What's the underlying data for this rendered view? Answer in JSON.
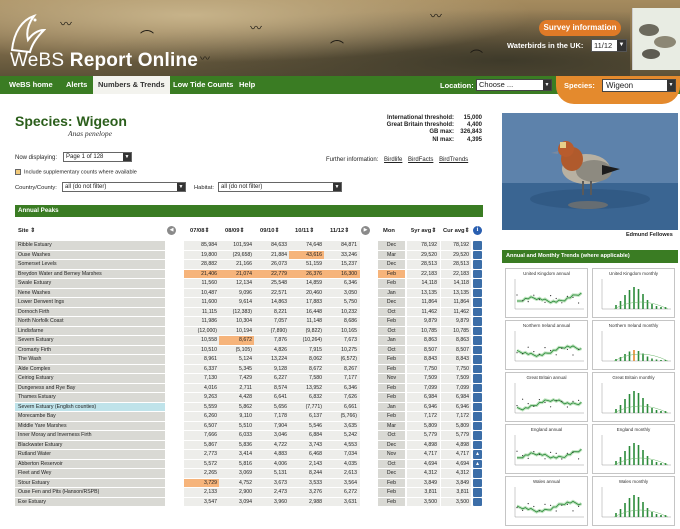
{
  "header": {
    "logo_prefix": "WeBS",
    "logo_suffix": "Report Online",
    "survey_button": "Survey information",
    "waterbirds_label": "Waterbirds in the UK:",
    "waterbirds_year": "11/12"
  },
  "nav": {
    "items": [
      "WeBS home",
      "Alerts",
      "Numbers & Trends",
      "Low Tide Counts",
      "Help"
    ],
    "location_label": "Location:",
    "location_value": "Choose ...",
    "species_label": "Species:",
    "species_value": "Wigeon"
  },
  "species": {
    "title": "Species: Wigeon",
    "latin": "Anas penelope"
  },
  "thresholds": [
    {
      "label": "International threshold:",
      "value": "15,000"
    },
    {
      "label": "Great Britain threshold:",
      "value": "4,400"
    },
    {
      "label": "GB max:",
      "value": "326,843"
    },
    {
      "label": "NI max:",
      "value": "4,395"
    }
  ],
  "further_info": {
    "label": "Further information:",
    "links": [
      "Birdlife",
      "BirdFacts",
      "BirdTrends"
    ]
  },
  "controls": {
    "displaying_label": "Now displaying:",
    "page_value": "Page 1 of 128",
    "supplementary_label": "Include supplementary counts where available",
    "country_label": "Country/County:",
    "country_value": "all (do not filter)",
    "habitat_label": "Habitat:",
    "habitat_value": "all (do not filter)"
  },
  "table": {
    "title": "Annual Peaks",
    "headers": {
      "site": "Site",
      "years": [
        "07/08",
        "08/09",
        "09/10",
        "10/11",
        "11/12"
      ],
      "mon": "Mon",
      "avg1": "5yr avg",
      "avg2": "Cur avg"
    },
    "rows": [
      {
        "site": "Ribble Estuary",
        "vals": [
          "85,984",
          "101,594",
          "84,633",
          "74,648",
          "84,871"
        ],
        "mon": "Dec",
        "avg1": "78,192",
        "avg2": "78,192",
        "status": "blue"
      },
      {
        "site": "Ouse Washes",
        "vals": [
          "19,800",
          "(29,658)",
          "21,884",
          "43,616",
          "33,246"
        ],
        "mon": "Mar",
        "avg1": "29,520",
        "avg2": "29,520",
        "status": "blue",
        "hl_col": 3
      },
      {
        "site": "Somerset Levels",
        "vals": [
          "28,882",
          "21,166",
          "26,073",
          "51,159",
          "15,237"
        ],
        "mon": "Dec",
        "avg1": "28,513",
        "avg2": "28,513",
        "status": "blue"
      },
      {
        "site": "Breydon Water and Berney Marshes",
        "vals": [
          "21,406",
          "21,074",
          "22,779",
          "26,376",
          "16,300"
        ],
        "mon": "Feb",
        "avg1": "22,183",
        "avg2": "22,183",
        "status": "blue",
        "hl_row": true
      },
      {
        "site": "Swale Estuary",
        "vals": [
          "11,560",
          "12,134",
          "25,548",
          "14,859",
          "6,346"
        ],
        "mon": "Feb",
        "avg1": "14,118",
        "avg2": "14,118",
        "status": "blue"
      },
      {
        "site": "Nene Washes",
        "vals": [
          "10,487",
          "9,096",
          "22,571",
          "20,460",
          "3,050"
        ],
        "mon": "Jan",
        "avg1": "13,135",
        "avg2": "13,135",
        "status": "blue"
      },
      {
        "site": "Lower Derwent Ings",
        "vals": [
          "11,600",
          "9,614",
          "14,863",
          "17,883",
          "5,750"
        ],
        "mon": "Dec",
        "avg1": "11,864",
        "avg2": "11,864",
        "status": "blue"
      },
      {
        "site": "Dornoch Firth",
        "vals": [
          "11,115",
          "(12,383)",
          "8,221",
          "16,448",
          "10,232"
        ],
        "mon": "Oct",
        "avg1": "11,462",
        "avg2": "11,462",
        "status": "blue"
      },
      {
        "site": "North Norfolk Coast",
        "vals": [
          "11,986",
          "10,304",
          "7,057",
          "11,148",
          "8,686"
        ],
        "mon": "Feb",
        "avg1": "9,879",
        "avg2": "9,879",
        "status": "blue"
      },
      {
        "site": "Lindisfarne",
        "vals": [
          "(12,000)",
          "10,194",
          "(7,890)",
          "(9,822)",
          "10,165"
        ],
        "mon": "Oct",
        "avg1": "10,785",
        "avg2": "10,785",
        "status": "blue"
      },
      {
        "site": "Severn Estuary",
        "vals": [
          "10,558",
          "8,672",
          "7,876",
          "(10,264)",
          "7,673"
        ],
        "mon": "Jan",
        "avg1": "8,863",
        "avg2": "8,863",
        "status": "blue",
        "hl_col": 1
      },
      {
        "site": "Cromarty Firth",
        "vals": [
          "10,510",
          "(5,105)",
          "4,826",
          "7,915",
          "10,275"
        ],
        "mon": "Oct",
        "avg1": "8,507",
        "avg2": "8,507",
        "status": "blue"
      },
      {
        "site": "The Wash",
        "vals": [
          "8,961",
          "5,124",
          "13,224",
          "8,062",
          "(6,572)"
        ],
        "mon": "Feb",
        "avg1": "8,843",
        "avg2": "8,843",
        "status": "blue"
      },
      {
        "site": "Alde Complex",
        "vals": [
          "6,337",
          "5,345",
          "9,128",
          "8,672",
          "8,267"
        ],
        "mon": "Feb",
        "avg1": "7,750",
        "avg2": "7,750",
        "status": "blue"
      },
      {
        "site": "Ceiriog Estuary",
        "vals": [
          "7,130",
          "7,429",
          "6,227",
          "7,580",
          "7,177"
        ],
        "mon": "Nov",
        "avg1": "7,509",
        "avg2": "7,509",
        "status": "blue"
      },
      {
        "site": "Dungeness and Rye Bay",
        "vals": [
          "4,016",
          "2,711",
          "8,574",
          "13,952",
          "6,346"
        ],
        "mon": "Feb",
        "avg1": "7,099",
        "avg2": "7,099",
        "status": "blue"
      },
      {
        "site": "Thames Estuary",
        "vals": [
          "9,263",
          "4,428",
          "6,641",
          "6,832",
          "7,626"
        ],
        "mon": "Feb",
        "avg1": "6,984",
        "avg2": "6,984",
        "status": "blue"
      },
      {
        "site": "Severn Estuary (English counties)",
        "vals": [
          "5,559",
          "5,862",
          "5,656",
          "(7,771)",
          "6,661"
        ],
        "mon": "Jan",
        "avg1": "6,946",
        "avg2": "6,946",
        "status": "blue",
        "hl_site": true
      },
      {
        "site": "Morecambe Bay",
        "vals": [
          "6,260",
          "9,110",
          "7,178",
          "6,137",
          "(5,766)"
        ],
        "mon": "Feb",
        "avg1": "7,172",
        "avg2": "7,172",
        "status": "blue"
      },
      {
        "site": "Middle Yare Marshes",
        "vals": [
          "6,507",
          "5,510",
          "7,904",
          "5,546",
          "3,635"
        ],
        "mon": "Mar",
        "avg1": "5,809",
        "avg2": "5,809",
        "status": "blue"
      },
      {
        "site": "Inner Moray and Inverness Firth",
        "vals": [
          "7,666",
          "6,033",
          "3,046",
          "6,884",
          "5,242"
        ],
        "mon": "Oct",
        "avg1": "5,779",
        "avg2": "5,779",
        "status": "blue"
      },
      {
        "site": "Blackwater Estuary",
        "vals": [
          "5,867",
          "5,836",
          "4,722",
          "3,743",
          "4,553"
        ],
        "mon": "Dec",
        "avg1": "4,898",
        "avg2": "4,898",
        "status": "blue"
      },
      {
        "site": "Rutland Water",
        "vals": [
          "2,773",
          "3,414",
          "4,883",
          "6,468",
          "7,034"
        ],
        "mon": "Nov",
        "avg1": "4,717",
        "avg2": "4,717",
        "status": "arrow"
      },
      {
        "site": "Abberton Reservoir",
        "vals": [
          "5,572",
          "5,816",
          "4,006",
          "2,143",
          "4,035"
        ],
        "mon": "Oct",
        "avg1": "4,694",
        "avg2": "4,694",
        "status": "arrow"
      },
      {
        "site": "Fleet and Wey",
        "vals": [
          "2,265",
          "3,069",
          "5,131",
          "8,244",
          "2,613"
        ],
        "mon": "Dec",
        "avg1": "4,312",
        "avg2": "4,312",
        "status": "blue"
      },
      {
        "site": "Stour Estuary",
        "vals": [
          "3,729",
          "4,752",
          "3,673",
          "3,533",
          "3,564"
        ],
        "mon": "Feb",
        "avg1": "3,849",
        "avg2": "3,849",
        "status": "blue",
        "hl_col": 0
      },
      {
        "site": "Ouse Fen and Pits (Hanson/RSPB)",
        "vals": [
          "2,133",
          "2,900",
          "2,473",
          "3,276",
          "6,272"
        ],
        "mon": "Feb",
        "avg1": "3,811",
        "avg2": "3,811",
        "status": "blue"
      },
      {
        "site": "Exe Estuary",
        "vals": [
          "3,547",
          "3,094",
          "3,960",
          "2,988",
          "3,631"
        ],
        "mon": "Feb",
        "avg1": "3,500",
        "avg2": "3,500",
        "status": "blue"
      }
    ]
  },
  "photo": {
    "credit": "Edmund Fellowes"
  },
  "trends": {
    "title": "Annual and Monthly Trends (where applicable)",
    "charts": [
      {
        "title": "United Kingdom annual",
        "kind": "annual"
      },
      {
        "title": "United Kingdom monthly",
        "kind": "monthly"
      },
      {
        "title": "Northern Ireland annual",
        "kind": "annual"
      },
      {
        "title": "Northern Ireland monthly",
        "kind": "monthly"
      },
      {
        "title": "Great Britain annual",
        "kind": "annual"
      },
      {
        "title": "Great Britain monthly",
        "kind": "monthly"
      },
      {
        "title": "England annual",
        "kind": "annual"
      },
      {
        "title": "England monthly",
        "kind": "monthly"
      },
      {
        "title": "Wales annual",
        "kind": "annual"
      },
      {
        "title": "Wales monthly",
        "kind": "monthly"
      }
    ]
  },
  "colors": {
    "brand_green": "#3a7c23",
    "accent_orange": "#e48a2d",
    "status_blue": "#3c6ea8",
    "highlight_orange": "#f6b47b"
  }
}
